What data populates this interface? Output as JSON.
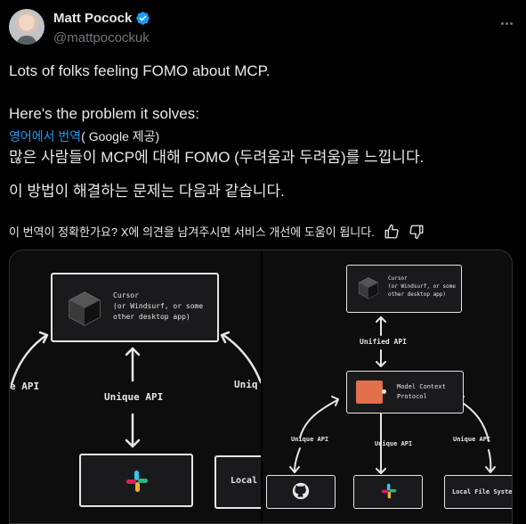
{
  "author": {
    "display_name": "Matt Pocock",
    "handle": "@mattpocockuk"
  },
  "tweet": {
    "line1": "Lots of folks feeling FOMO about MCP.",
    "line2": "Here's the problem it solves:"
  },
  "translation": {
    "link": "영어에서 번역",
    "provider": "( Google 제공)",
    "line1": "많은 사람들이 MCP에 대해 FOMO (두려움과 두려움)를 느낍니다.",
    "line2": "이 방법이 해결하는 문제는 다음과 같습니다.",
    "feedback": "이 번역이 정확한가요? X에 의견을 남겨주시면 서비스 개선에 도움이 됩니다."
  },
  "diagram_left": {
    "cursor_text": "Cursor\n(or Windsurf, or some\nother desktop app)",
    "left_api": "e API",
    "center_api": "Unique API",
    "right_api": "Uniq",
    "local_box": "Local F"
  },
  "diagram_right": {
    "cursor_text": "Cursor\n(or Windsurf, or some\nother desktop app)",
    "unified_api": "Unified API",
    "mcp_text": "Model Context\nProtocol",
    "api_left": "Unique API",
    "api_center": "Unique API",
    "api_right": "Unique API",
    "local_box": "Local File System"
  },
  "colors": {
    "accent": "#1d9bf0",
    "background": "#000000",
    "muted": "#71767b",
    "mcp_logo": "#e2704a"
  },
  "icons": [
    "verified-badge-icon",
    "more-icon",
    "thumbs-up-icon",
    "thumbs-down-icon",
    "cursor-logo-icon",
    "slack-logo-icon",
    "github-logo-icon",
    "mcp-logo-icon"
  ]
}
